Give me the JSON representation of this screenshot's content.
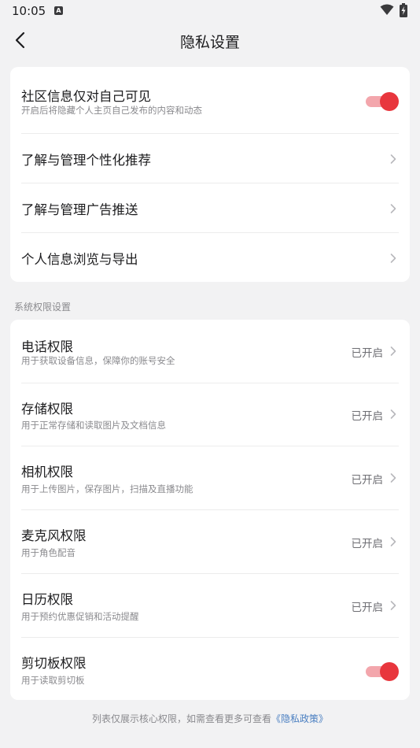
{
  "status_bar": {
    "time": "10:05",
    "notification_icon": "A"
  },
  "header": {
    "title": "隐私设置"
  },
  "card1": {
    "community": {
      "title": "社区信息仅对自己可见",
      "subtitle": "开启后将隐藏个人主页自己发布的内容和动态",
      "enabled": true
    },
    "personalized": {
      "title": "了解与管理个性化推荐"
    },
    "ads": {
      "title": "了解与管理广告推送"
    },
    "export": {
      "title": "个人信息浏览与导出"
    }
  },
  "section_label": "系统权限设置",
  "permissions": [
    {
      "title": "电话权限",
      "subtitle": "用于获取设备信息，保障你的账号安全",
      "status": "已开启"
    },
    {
      "title": "存储权限",
      "subtitle": "用于正常存储和读取图片及文档信息",
      "status": "已开启"
    },
    {
      "title": "相机权限",
      "subtitle": "用于上传图片，保存图片，扫描及直播功能",
      "status": "已开启"
    },
    {
      "title": "麦克风权限",
      "subtitle": "用于角色配音",
      "status": "已开启"
    },
    {
      "title": "日历权限",
      "subtitle": "用于预约优惠促销和活动提醒",
      "status": "已开启"
    }
  ],
  "clipboard": {
    "title": "剪切板权限",
    "subtitle": "用于读取剪切板",
    "enabled": true
  },
  "footer": {
    "text": "列表仅展示核心权限，如需查看更多可查看",
    "link": "《隐私政策》"
  },
  "colors": {
    "accent": "#e8363d",
    "track": "#f3a6ac",
    "background": "#f2f2f3"
  }
}
